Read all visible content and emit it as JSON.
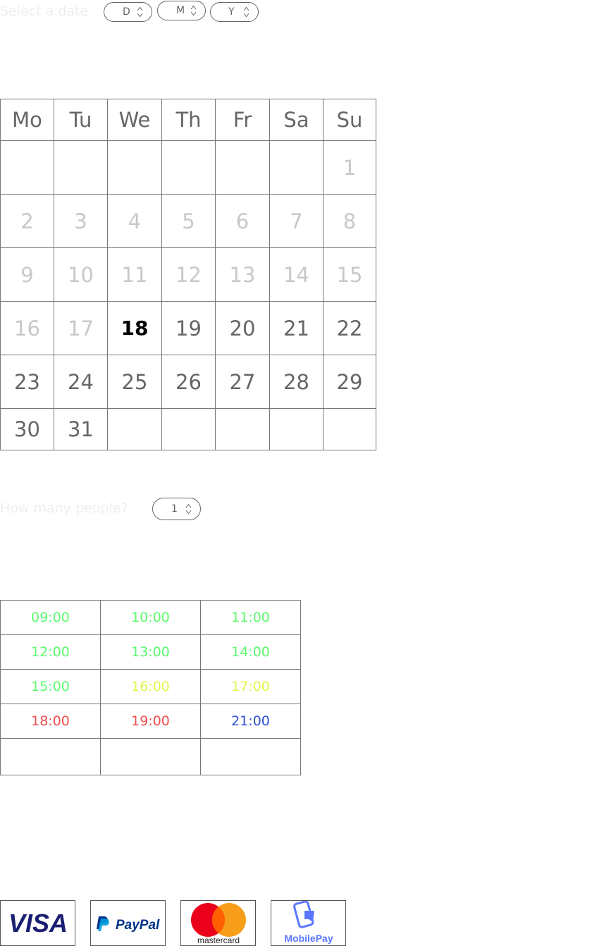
{
  "date_select": {
    "label": "Select a date",
    "day": "D",
    "month": "M",
    "year": "Y"
  },
  "calendar": {
    "weekdays": [
      "Mo",
      "Tu",
      "We",
      "Th",
      "Fr",
      "Sa",
      "Su"
    ],
    "weeks": [
      [
        "",
        "",
        "",
        "",
        "",
        "",
        "1"
      ],
      [
        "2",
        "3",
        "4",
        "5",
        "6",
        "7",
        "8"
      ],
      [
        "9",
        "10",
        "11",
        "12",
        "13",
        "14",
        "15"
      ],
      [
        "16",
        "17",
        "18",
        "19",
        "20",
        "21",
        "22"
      ],
      [
        "23",
        "24",
        "25",
        "26",
        "27",
        "28",
        "29"
      ],
      [
        "30",
        "31",
        "",
        "",
        "",
        "",
        ""
      ]
    ],
    "today": "18"
  },
  "people": {
    "label": "How many people?",
    "value": "1"
  },
  "time_slots": {
    "rows": [
      [
        {
          "time": "09:00",
          "color": "#5dfa6e"
        },
        {
          "time": "10:00",
          "color": "#5dfa6e"
        },
        {
          "time": "11:00",
          "color": "#5dfa6e"
        }
      ],
      [
        {
          "time": "12:00",
          "color": "#5dfa6e"
        },
        {
          "time": "13:00",
          "color": "#5dfa6e"
        },
        {
          "time": "14:00",
          "color": "#5dfa6e"
        }
      ],
      [
        {
          "time": "15:00",
          "color": "#5dfa6e"
        },
        {
          "time": "16:00",
          "color": "#e3f54a"
        },
        {
          "time": "17:00",
          "color": "#e3f54a"
        }
      ],
      [
        {
          "time": "18:00",
          "color": "#f04e4e"
        },
        {
          "time": "19:00",
          "color": "#f04e4e"
        },
        {
          "time": "21:00",
          "color": "#2e4fd6"
        }
      ],
      [
        {
          "time": "",
          "color": ""
        },
        {
          "time": "",
          "color": ""
        },
        {
          "time": "",
          "color": ""
        }
      ]
    ]
  },
  "payment": {
    "visa": "VISA",
    "paypal": "PayPal",
    "mastercard": "mastercard",
    "mobilepay": "MobilePay"
  }
}
